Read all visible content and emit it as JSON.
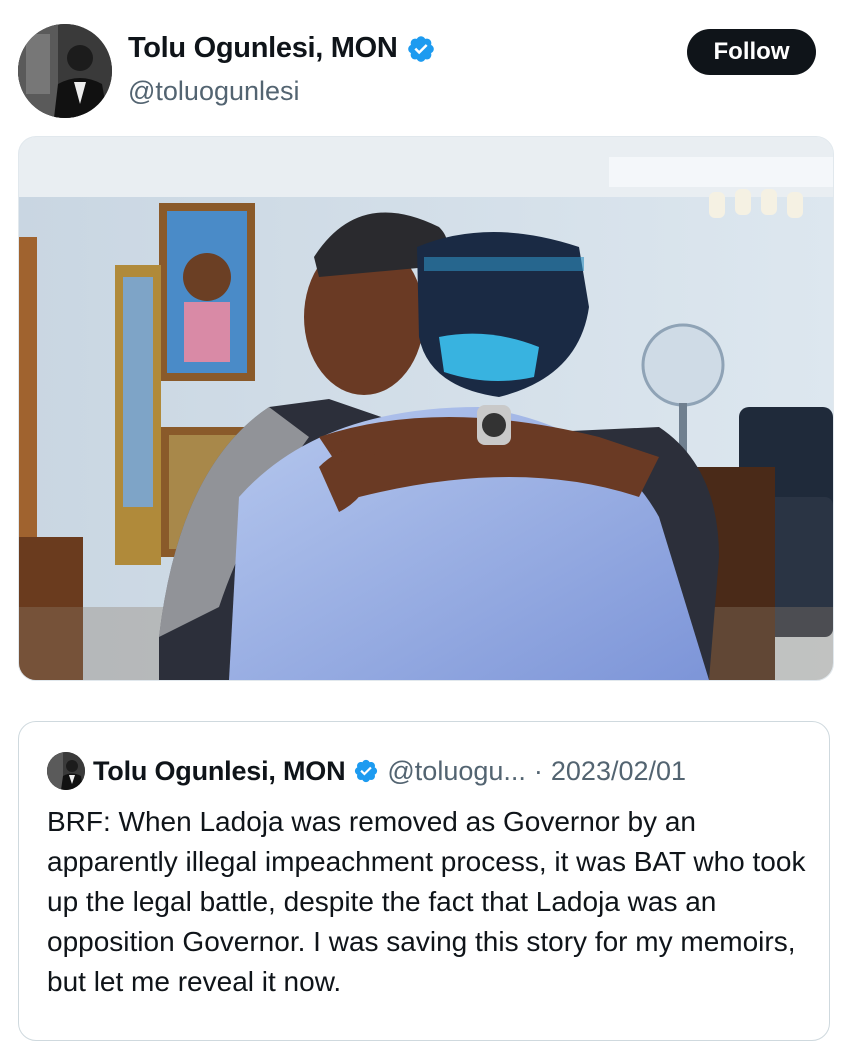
{
  "tweet": {
    "author_name": "Tolu Ogunlesi, MON",
    "author_handle": "@toluogunlesi",
    "follow_label": "Follow",
    "verified_color": "#1d9bf0"
  },
  "quoted_tweet": {
    "author_name": "Tolu Ogunlesi, MON",
    "author_handle": "@toluogu...",
    "separator": "·",
    "date": "2023/02/01",
    "text": "BRF: When Ladoja was removed as Governor by an apparently illegal impeachment process, it was BAT who took up the legal battle, despite the fact that Ladoja was an opposition Governor. I was saving this story for my memoirs, but let me reveal it now."
  },
  "icons": {
    "verified": "verified-badge-icon"
  }
}
